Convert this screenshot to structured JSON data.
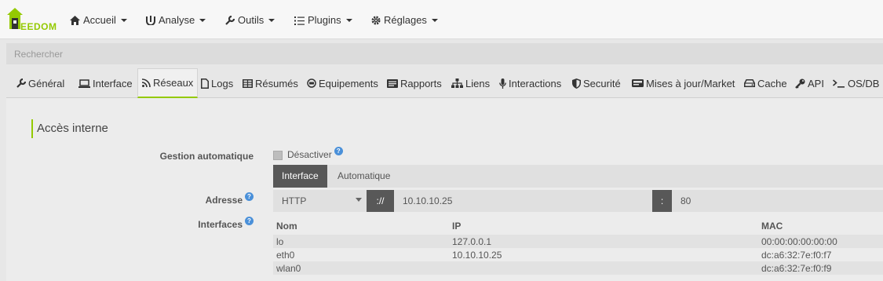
{
  "navbar": {
    "brand": "EEDOM",
    "items": [
      {
        "label": "Accueil",
        "icon": "home-icon"
      },
      {
        "label": "Analyse",
        "icon": "analysis-icon"
      },
      {
        "label": "Outils",
        "icon": "wrench-icon"
      },
      {
        "label": "Plugins",
        "icon": "list-icon"
      },
      {
        "label": "Réglages",
        "icon": "gear-icon"
      }
    ]
  },
  "search": {
    "placeholder": "Rechercher"
  },
  "tabs": [
    {
      "label": "Général",
      "icon": "wrench-icon"
    },
    {
      "label": "Interface",
      "icon": "laptop-icon"
    },
    {
      "label": "Réseaux",
      "icon": "rss-icon",
      "active": true
    },
    {
      "label": "Logs",
      "icon": "file-icon"
    },
    {
      "label": "Résumés",
      "icon": "table-icon"
    },
    {
      "label": "Equipements",
      "icon": "plug-icon"
    },
    {
      "label": "Rapports",
      "icon": "report-icon"
    },
    {
      "label": "Liens",
      "icon": "sitemap-icon"
    },
    {
      "label": "Interactions",
      "icon": "microphone-icon"
    },
    {
      "label": "Securité",
      "icon": "shield-icon"
    },
    {
      "label": "Mises à jour/Market",
      "icon": "hdd-icon"
    },
    {
      "label": "Cache",
      "icon": "drive-icon"
    },
    {
      "label": "API",
      "icon": "key-icon"
    },
    {
      "label": "OS/DB",
      "icon": "terminal-icon"
    }
  ],
  "section": {
    "title": "Accès interne"
  },
  "form": {
    "auto_label": "Gestion automatique",
    "disable_label": "Désactiver",
    "mode_tabs": [
      "Interface",
      "Automatique"
    ],
    "address_label": "Adresse",
    "protocol": "HTTP",
    "separator": "://",
    "ip": "10.10.10.25",
    "port_sep": ":",
    "port": "80",
    "interfaces_label": "Interfaces",
    "help_glyph": "?"
  },
  "interfaces": {
    "headers": [
      "Nom",
      "IP",
      "MAC"
    ],
    "rows": [
      [
        "lo",
        "127.0.0.1",
        "00:00:00:00:00:00"
      ],
      [
        "eth0",
        "10.10.10.25",
        "dc:a6:32:7e:f0:f7"
      ],
      [
        "wlan0",
        "",
        "dc:a6:32:7e:f0:f9"
      ]
    ]
  },
  "colors": {
    "accent": "#94ca02",
    "dark": "#585858",
    "help": "#4a90d9"
  }
}
